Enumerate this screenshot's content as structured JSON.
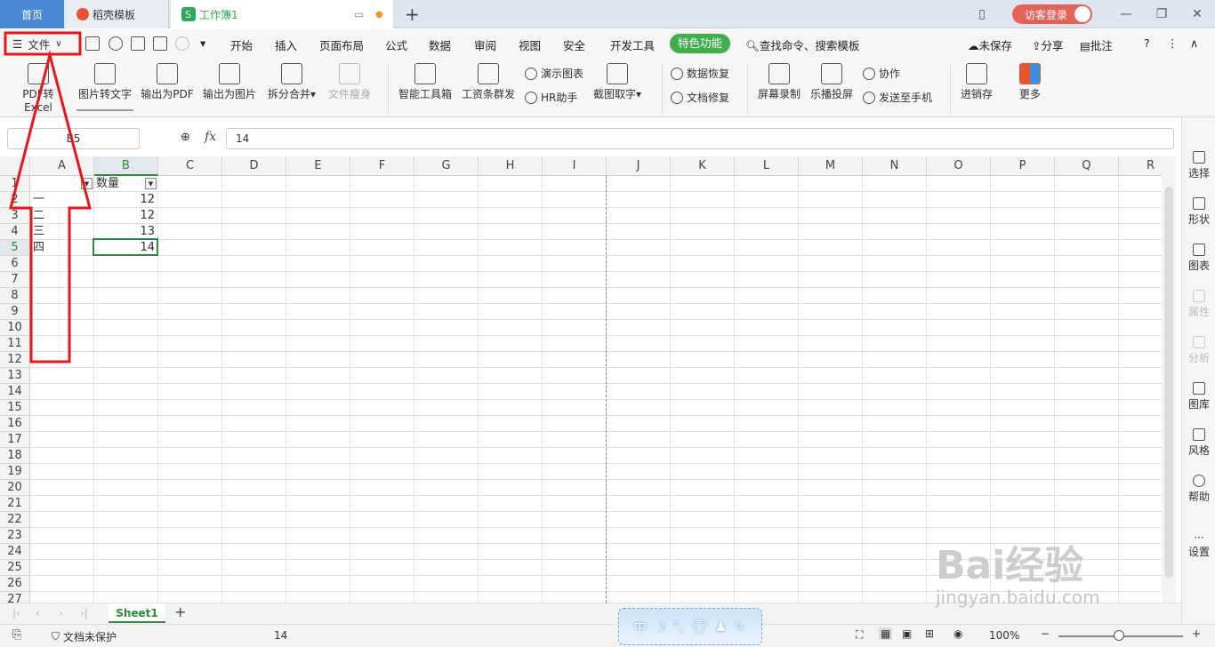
{
  "tabs": {
    "home": "首页",
    "template": "稻壳模板",
    "workbook": "工作簿1"
  },
  "login": "访客登录",
  "menu": {
    "file": "文件",
    "items": [
      "开始",
      "插入",
      "页面布局",
      "公式",
      "数据",
      "审阅",
      "视图",
      "安全",
      "开发工具"
    ],
    "special": "特色功能",
    "search": "查找命令、搜索模板",
    "unsaved": "未保存",
    "share": "分享",
    "comment": "批注"
  },
  "ribbon": {
    "pdf_excel": "PDF转Excel",
    "img_text": "图片转文字",
    "out_pdf": "输出为PDF",
    "out_img": "输出为图片",
    "split": "拆分合并",
    "slim": "文件瘦身",
    "smart": "智能工具箱",
    "salary": "工资条群发",
    "chart_demo": "演示图表",
    "hr": "HR助手",
    "screenshot": "截图取字",
    "recover": "数据恢复",
    "repair": "文档修复",
    "record": "屏幕录制",
    "cast": "乐播投屏",
    "collab": "协作",
    "send": "发送至手机",
    "inventory": "进销存",
    "more": "更多"
  },
  "formula": {
    "name": "B5",
    "fx": "fx",
    "value": "14"
  },
  "columns": [
    "A",
    "B",
    "C",
    "D",
    "E",
    "F",
    "G",
    "H",
    "I",
    "J",
    "K",
    "L",
    "M",
    "N",
    "O",
    "P",
    "Q",
    "R"
  ],
  "rows": [
    "1",
    "2",
    "3",
    "4",
    "5",
    "6",
    "7",
    "8",
    "9",
    "10",
    "11",
    "12",
    "13",
    "14",
    "15",
    "16",
    "17",
    "18",
    "19",
    "20",
    "21",
    "22",
    "23",
    "24",
    "25",
    "26",
    "27"
  ],
  "cells": {
    "B1": "数量",
    "A2": "一",
    "B2": "12",
    "A3": "二",
    "B3": "12",
    "A4": "三",
    "B4": "13",
    "A5": "四",
    "B5": "14"
  },
  "right_panel": [
    "选择",
    "形状",
    "图表",
    "属性",
    "分析",
    "图库",
    "风格",
    "帮助",
    "设置"
  ],
  "sheet": "Sheet1",
  "status": {
    "protect": "文档未保护",
    "value": "14",
    "zoom": "100%"
  },
  "ime": "中",
  "watermark": {
    "main": "Bai经验",
    "sub": "jingyan.baidu.com"
  },
  "colors": {
    "accent": "#2b8a3e",
    "annotation": "#e8151b",
    "tab_home": "#4a8ad4"
  }
}
